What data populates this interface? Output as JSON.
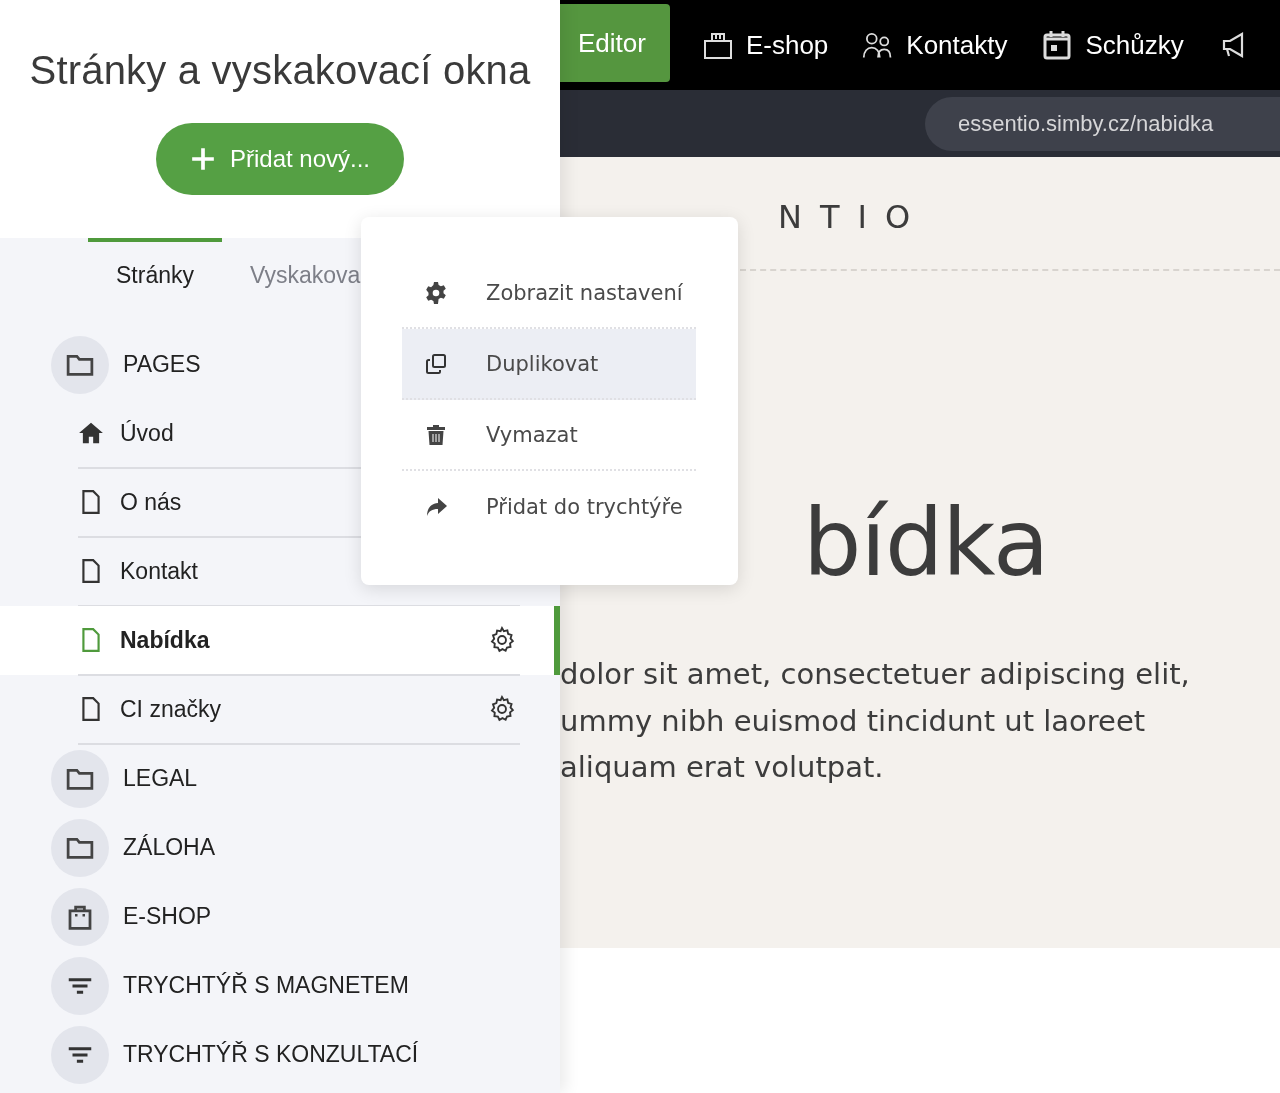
{
  "sidebar": {
    "title": "Stránky a vyskakovací okna",
    "add_button": "Přidat nový...",
    "tabs": [
      {
        "label": "Stránky",
        "selected": true
      },
      {
        "label": "Vyskakova",
        "selected": false
      }
    ],
    "tree": [
      {
        "kind": "folder",
        "label": "PAGES",
        "children": [
          {
            "kind": "home",
            "label": "Úvod",
            "selected": false,
            "settings_icon": false
          },
          {
            "kind": "page",
            "label": "O nás",
            "selected": false,
            "settings_icon": false
          },
          {
            "kind": "page",
            "label": "Kontakt",
            "selected": false,
            "settings_icon": false
          },
          {
            "kind": "page",
            "label": "Nabídka",
            "selected": true,
            "settings_icon": true
          },
          {
            "kind": "page",
            "label": "CI značky",
            "selected": false,
            "settings_icon": true
          }
        ]
      },
      {
        "kind": "folder",
        "label": "LEGAL"
      },
      {
        "kind": "folder",
        "label": "ZÁLOHA"
      },
      {
        "kind": "shop",
        "label": "E-SHOP"
      },
      {
        "kind": "funnel",
        "label": "TRYCHTÝŘ S MAGNETEM"
      },
      {
        "kind": "funnel",
        "label": "TRYCHTÝŘ S KONZULTACÍ"
      }
    ]
  },
  "context_menu": [
    {
      "kind": "settings",
      "label": "Zobrazit nastavení",
      "selected": false
    },
    {
      "kind": "copy",
      "label": "Duplikovat",
      "selected": true
    },
    {
      "kind": "delete",
      "label": "Vymazat",
      "selected": false
    },
    {
      "kind": "forward",
      "label": "Přidat do trychtýře",
      "selected": false
    }
  ],
  "top_nav": [
    {
      "kind": "editor",
      "label": "Editor",
      "selected": true
    },
    {
      "kind": "shop",
      "label": "E-shop",
      "selected": false
    },
    {
      "kind": "contacts",
      "label": "Kontakty",
      "selected": false
    },
    {
      "kind": "calendar",
      "label": "Schůzky",
      "selected": false
    },
    {
      "kind": "megaphone",
      "selected": false
    }
  ],
  "url_bar": "essentio.simby.cz/nabidka",
  "preview": {
    "logo": "NTIO",
    "heading": "bídka",
    "lines": [
      "dolor sit amet, consectetuer adipiscing elit,",
      "ummy nibh euismod tincidunt ut laoreet",
      "aliquam erat volutpat."
    ]
  }
}
